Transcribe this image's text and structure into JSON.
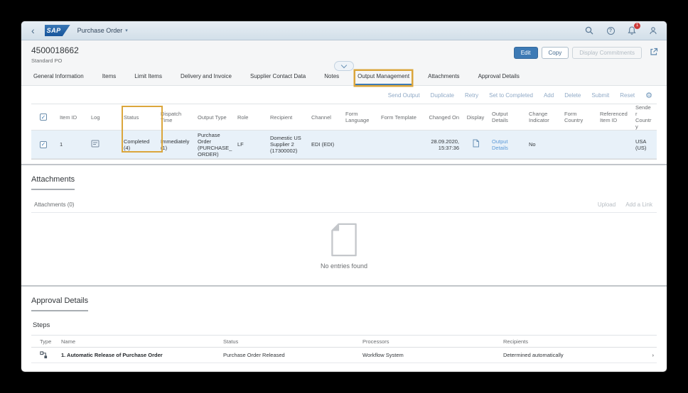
{
  "icons": {
    "back": "‹",
    "title_caret": "▾",
    "check": "✓",
    "gear": "⚙",
    "row_chevron": "›",
    "help": "?"
  },
  "shell": {
    "app_title": "Purchase Order",
    "logo_text": "SAP",
    "notification_count": "1"
  },
  "header": {
    "title": "4500018662",
    "subtitle": "Standard PO",
    "actions": {
      "edit": "Edit",
      "copy": "Copy",
      "display_commitments": "Display Commitments"
    }
  },
  "tabs": {
    "items": [
      "General Information",
      "Items",
      "Limit Items",
      "Delivery and Invoice",
      "Supplier Contact Data",
      "Notes",
      "Output Management",
      "Attachments",
      "Approval Details"
    ],
    "selected": "Output Management"
  },
  "output_management": {
    "toolbar": [
      "Send Output",
      "Duplicate",
      "Retry",
      "Set to Completed",
      "Add",
      "Delete",
      "Submit",
      "Reset"
    ],
    "columns": [
      "Item ID",
      "Log",
      "Status",
      "Dispatch Time",
      "Output Type",
      "Role",
      "Recipient",
      "Channel",
      "Form Language",
      "Form Template",
      "Changed On",
      "Display",
      "Output Details",
      "Change Indicator",
      "Form Country",
      "Referenced Item ID",
      "Sender Country"
    ],
    "row": {
      "item_id": "1",
      "status": "Completed (4)",
      "dispatch_time": "Immediately (1)",
      "output_type": "Purchase Order (PURCHASE_ORDER)",
      "role": "LF",
      "recipient": "Domestic US Supplier 2 (17300002)",
      "channel": "EDI (EDI)",
      "changed_on": "28.09.2020, 15:37:36",
      "output_details": "Output Details",
      "change_indicator": "No",
      "sender_country": "USA (US)"
    }
  },
  "attachments": {
    "section_title": "Attachments",
    "count_label": "Attachments (0)",
    "upload_label": "Upload",
    "add_link_label": "Add a Link",
    "empty_text": "No entries found"
  },
  "approval": {
    "section_title": "Approval Details",
    "steps_title": "Steps",
    "columns": [
      "Type",
      "Name",
      "Status",
      "Processors",
      "Recipients"
    ],
    "row": {
      "name": "1. Automatic Release of Purchase Order",
      "status": "Purchase Order Released",
      "processors": "Workflow System",
      "recipients": "Determined automatically"
    }
  }
}
